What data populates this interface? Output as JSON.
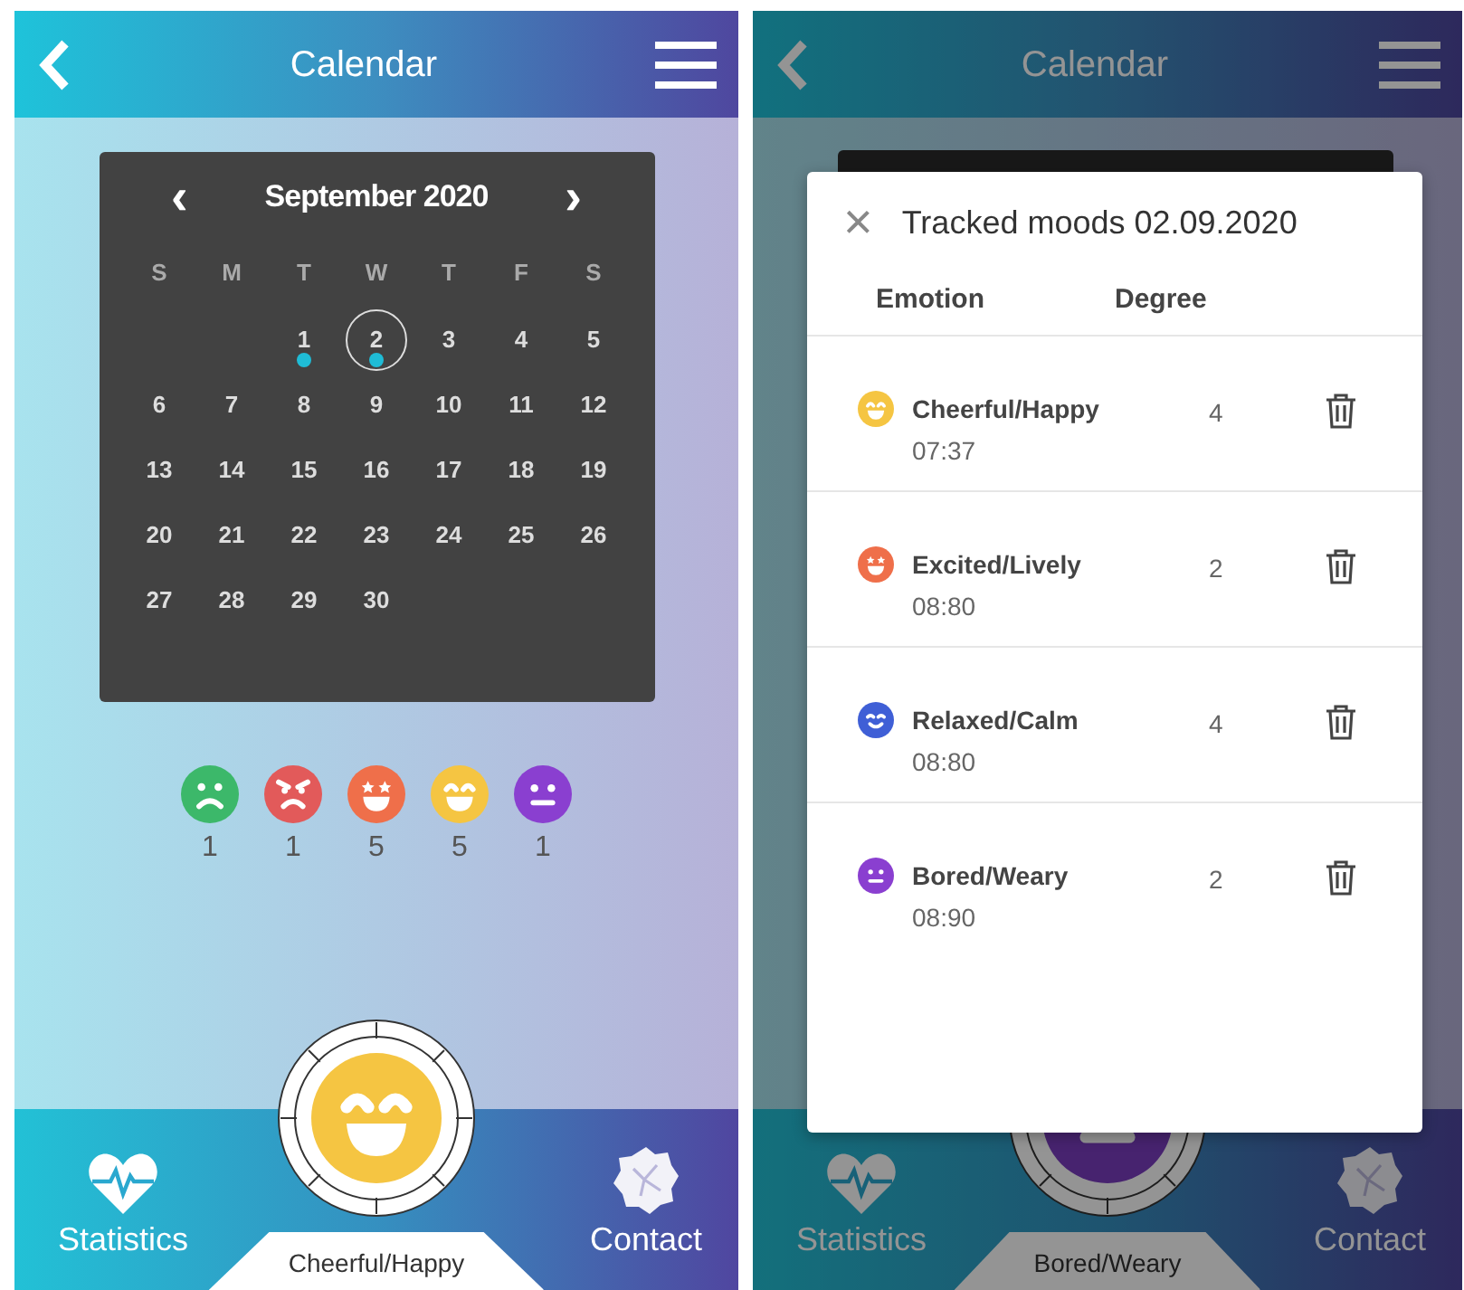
{
  "calendar_screen": {
    "header": {
      "title": "Calendar"
    },
    "calendar": {
      "month": "September 2020",
      "prev": "‹",
      "next": "›",
      "weekdays": [
        "S",
        "M",
        "T",
        "W",
        "T",
        "F",
        "S"
      ],
      "weeks": [
        [
          {
            "kind": "empty"
          },
          {
            "kind": "empty"
          },
          {
            "kind": "day",
            "day": "1",
            "marked": true,
            "selected": false
          },
          {
            "kind": "day",
            "day": "2",
            "marked": true,
            "selected": true
          },
          {
            "kind": "day",
            "day": "3",
            "marked": false,
            "selected": false
          },
          {
            "kind": "day",
            "day": "4",
            "marked": false,
            "selected": false
          },
          {
            "kind": "day",
            "day": "5",
            "marked": false,
            "selected": false
          }
        ],
        [
          {
            "kind": "day",
            "day": "6",
            "marked": false,
            "selected": false
          },
          {
            "kind": "day",
            "day": "7",
            "marked": false,
            "selected": false
          },
          {
            "kind": "day",
            "day": "8",
            "marked": false,
            "selected": false
          },
          {
            "kind": "day",
            "day": "9",
            "marked": false,
            "selected": false
          },
          {
            "kind": "day",
            "day": "10",
            "marked": false,
            "selected": false
          },
          {
            "kind": "day",
            "day": "11",
            "marked": false,
            "selected": false
          },
          {
            "kind": "day",
            "day": "12",
            "marked": false,
            "selected": false
          }
        ],
        [
          {
            "kind": "day",
            "day": "13",
            "marked": false,
            "selected": false
          },
          {
            "kind": "day",
            "day": "14",
            "marked": false,
            "selected": false
          },
          {
            "kind": "day",
            "day": "15",
            "marked": false,
            "selected": false
          },
          {
            "kind": "day",
            "day": "16",
            "marked": false,
            "selected": false
          },
          {
            "kind": "day",
            "day": "17",
            "marked": false,
            "selected": false
          },
          {
            "kind": "day",
            "day": "18",
            "marked": false,
            "selected": false
          },
          {
            "kind": "day",
            "day": "19",
            "marked": false,
            "selected": false
          }
        ],
        [
          {
            "kind": "day",
            "day": "20",
            "marked": false,
            "selected": false
          },
          {
            "kind": "day",
            "day": "21",
            "marked": false,
            "selected": false
          },
          {
            "kind": "day",
            "day": "22",
            "marked": false,
            "selected": false
          },
          {
            "kind": "day",
            "day": "23",
            "marked": false,
            "selected": false
          },
          {
            "kind": "day",
            "day": "24",
            "marked": false,
            "selected": false
          },
          {
            "kind": "day",
            "day": "25",
            "marked": false,
            "selected": false
          },
          {
            "kind": "day",
            "day": "26",
            "marked": false,
            "selected": false
          }
        ],
        [
          {
            "kind": "day",
            "day": "27",
            "marked": false,
            "selected": false
          },
          {
            "kind": "day",
            "day": "28",
            "marked": false,
            "selected": false
          },
          {
            "kind": "day",
            "day": "29",
            "marked": false,
            "selected": false
          },
          {
            "kind": "day",
            "day": "30",
            "marked": false,
            "selected": false
          }
        ]
      ]
    },
    "mood_counts": [
      {
        "kind": "sad",
        "color": "#3cb86a",
        "count": "1"
      },
      {
        "kind": "angry",
        "color": "#e25a5a",
        "count": "1"
      },
      {
        "kind": "excited",
        "color": "#ef6f4a",
        "count": "5"
      },
      {
        "kind": "happy",
        "color": "#f5c542",
        "count": "5"
      },
      {
        "kind": "neutral",
        "color": "#8a3fd0",
        "count": "1"
      }
    ],
    "current_mood": {
      "kind": "happy",
      "label": "Cheerful/Happy"
    },
    "nav": [
      {
        "kind": "statistics",
        "label": "Statistics"
      },
      {
        "kind": "contact",
        "label": "Contact"
      }
    ]
  },
  "mood_screen": {
    "header": {
      "title": "Calendar"
    },
    "dialog": {
      "close": "×",
      "title": "Tracked moods 02.09.2020",
      "columns": [
        "Emotion",
        "Degree"
      ],
      "entries": [
        {
          "kind": "happy",
          "color": "#f5c542",
          "emotion": "Cheerful/Happy",
          "time": "07:37",
          "degree": "4"
        },
        {
          "kind": "excited",
          "color": "#ef6f4a",
          "emotion": "Excited/Lively",
          "time": "08:80",
          "degree": "2"
        },
        {
          "kind": "relaxed",
          "color": "#3f5fd6",
          "emotion": "Relaxed/Calm",
          "time": "08:80",
          "degree": "4"
        },
        {
          "kind": "neutral",
          "color": "#8a3fd0",
          "emotion": "Bored/Weary",
          "time": "08:90",
          "degree": "2"
        }
      ]
    },
    "current_mood": {
      "kind": "neutral",
      "label": "Bored/Weary"
    },
    "nav": [
      {
        "kind": "statistics",
        "label": "Statistics"
      },
      {
        "kind": "contact",
        "label": "Contact"
      }
    ]
  }
}
